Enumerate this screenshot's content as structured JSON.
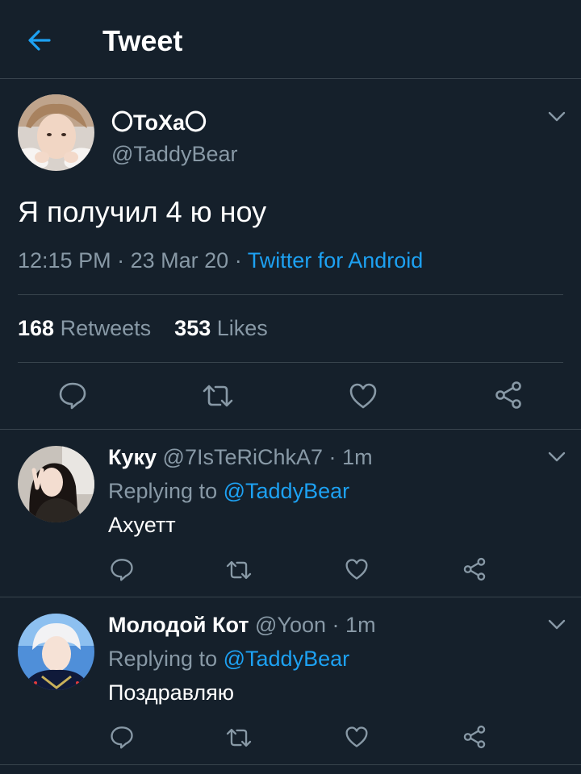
{
  "header": {
    "title": "Tweet"
  },
  "tweet": {
    "display_name": "〇ToXa〇",
    "handle": "@TaddyBear",
    "text": "Я получил 4 ю ноу",
    "time": "12:15 PM",
    "date": "23 Mar 20",
    "source": "Twitter for Android",
    "retweets_count": "168",
    "retweets_label": "Retweets",
    "likes_count": "353",
    "likes_label": "Likes"
  },
  "replies": [
    {
      "name": "Куку",
      "handle": "@7IsTeRiChkA7",
      "time": "1m",
      "replying_prefix": "Replying to",
      "replying_to": "@TaddyBear",
      "text": "Ахуетт"
    },
    {
      "name": "Молодой Кот",
      "handle": "@Yoon",
      "time": "1m",
      "replying_prefix": "Replying to",
      "replying_to": "@TaddyBear",
      "text": "Поздравляю"
    }
  ],
  "colors": {
    "background": "#15202b",
    "accent": "#1da1f2",
    "muted": "#8899a6",
    "divider": "#38444d"
  },
  "icons": [
    "arrow-left-icon",
    "chevron-down-icon",
    "reply-icon",
    "retweet-icon",
    "like-icon",
    "share-icon"
  ]
}
